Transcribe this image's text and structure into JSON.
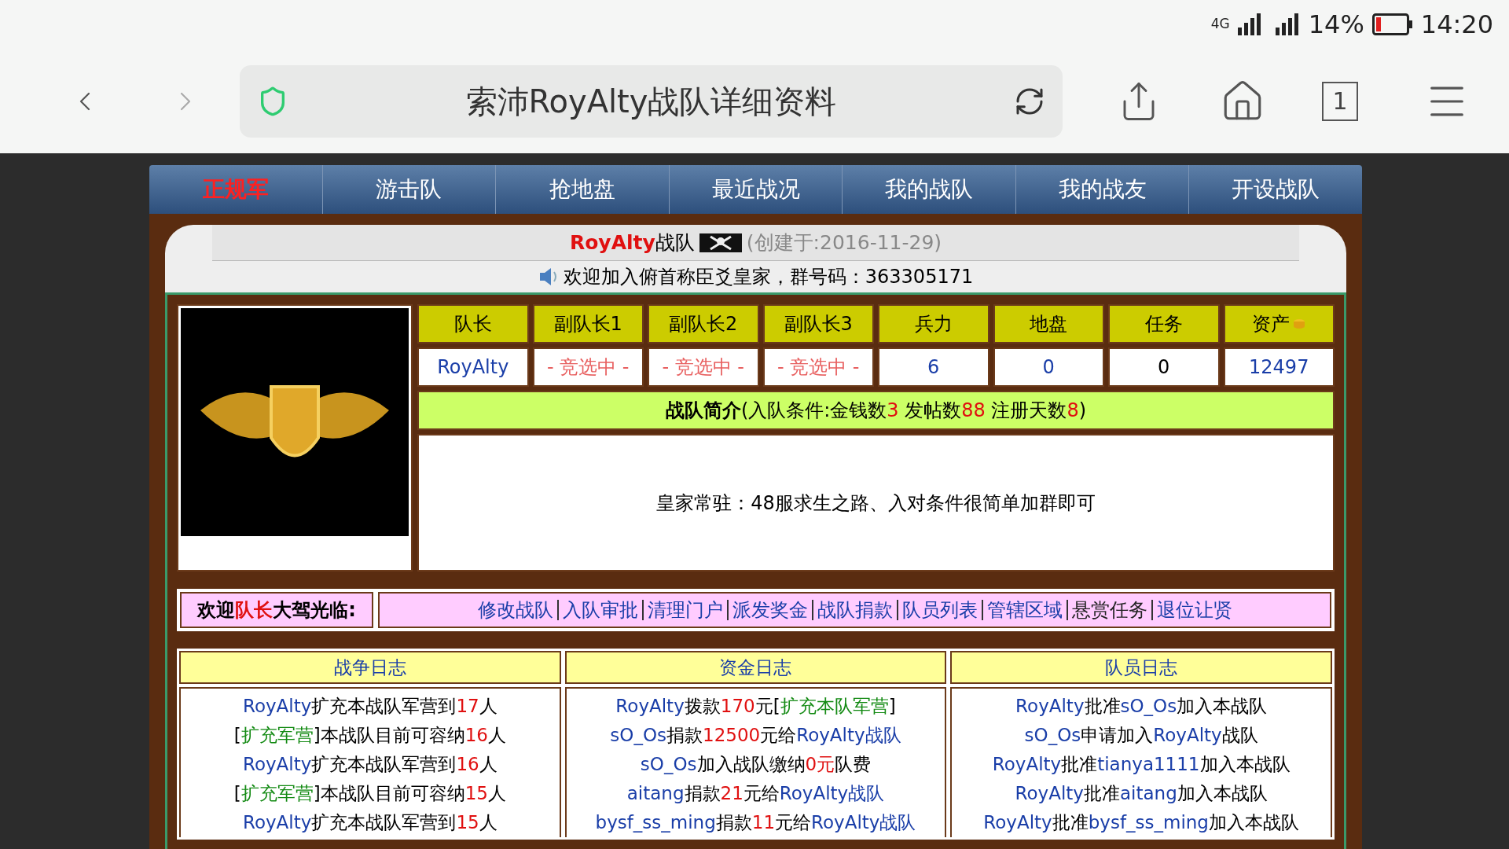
{
  "status_bar": {
    "network": "4G",
    "battery": "14%",
    "time": "14:20"
  },
  "browser": {
    "page_title": "索沛RoyAlty战队详细资料",
    "tab_count": "1"
  },
  "nav_tabs": [
    {
      "label": "正规军",
      "selected": true
    },
    {
      "label": "游击队",
      "selected": false
    },
    {
      "label": "抢地盘",
      "selected": false
    },
    {
      "label": "最近战况",
      "selected": false
    },
    {
      "label": "我的战队",
      "selected": false
    },
    {
      "label": "我的战友",
      "selected": false
    },
    {
      "label": "开设战队",
      "selected": false
    }
  ],
  "team_header": {
    "title": [
      {
        "kind": "brand",
        "text": "RoyAlty"
      },
      {
        "kind": "text",
        "text": "战队"
      }
    ],
    "created": "(创建于:2016-11-29)",
    "notice": "欢迎加入俯首称臣爻皇家，群号码：363305171"
  },
  "stats": [
    {
      "label": "队长",
      "value": "RoyAlty",
      "kind": "name"
    },
    {
      "label": "副队长1",
      "value": "- 竞选中 -",
      "kind": "pending"
    },
    {
      "label": "副队长2",
      "value": "- 竞选中 -",
      "kind": "pending"
    },
    {
      "label": "副队长3",
      "value": "- 竞选中 -",
      "kind": "pending"
    },
    {
      "label": "兵力",
      "value": "6",
      "kind": "name"
    },
    {
      "label": "地盘",
      "value": "0",
      "kind": "name"
    },
    {
      "label": "任务",
      "value": "0",
      "kind": "text"
    },
    {
      "label": "资产",
      "value": "12497",
      "kind": "name",
      "coin": true
    }
  ],
  "intro": {
    "heading": [
      {
        "kind": "bold",
        "text": "战队简介"
      },
      {
        "kind": "text",
        "text": "(入队条件:金钱数"
      },
      {
        "kind": "number",
        "text": "3"
      },
      {
        "kind": "text",
        "text": " 发帖数"
      },
      {
        "kind": "number",
        "text": "88"
      },
      {
        "kind": "text",
        "text": " 注册天数"
      },
      {
        "kind": "number",
        "text": "8"
      },
      {
        "kind": "text",
        "text": ")"
      }
    ],
    "description": "皇家常驻：48服求生之路、入对条件很简单加群即可"
  },
  "welcome": [
    {
      "kind": "text",
      "text": "欢迎"
    },
    {
      "kind": "role",
      "text": "队长"
    },
    {
      "kind": "text",
      "text": "大驾光临:"
    }
  ],
  "actions": [
    {
      "label": "修改战队",
      "kind": "link"
    },
    {
      "label": "入队审批",
      "kind": "link"
    },
    {
      "label": "清理门户",
      "kind": "link"
    },
    {
      "label": "派发奖金",
      "kind": "link"
    },
    {
      "label": "战队捐款",
      "kind": "link"
    },
    {
      "label": "队员列表",
      "kind": "link"
    },
    {
      "label": "管辖区域",
      "kind": "link"
    },
    {
      "label": "悬赏任务",
      "kind": "plain"
    },
    {
      "label": "退位让贤",
      "kind": "link"
    }
  ],
  "logs": [
    {
      "title": "战争日志",
      "entries": [
        [
          {
            "kind": "name",
            "text": "RoyAlty"
          },
          {
            "kind": "text",
            "text": "扩充本战队军营到"
          },
          {
            "kind": "number",
            "text": "17"
          },
          {
            "kind": "text",
            "text": "人"
          }
        ],
        [
          {
            "kind": "text",
            "text": "["
          },
          {
            "kind": "tag",
            "text": "扩充军营"
          },
          {
            "kind": "text",
            "text": "]本战队目前可容纳"
          },
          {
            "kind": "number",
            "text": "16"
          },
          {
            "kind": "text",
            "text": "人"
          }
        ],
        [
          {
            "kind": "name",
            "text": "RoyAlty"
          },
          {
            "kind": "text",
            "text": "扩充本战队军营到"
          },
          {
            "kind": "number",
            "text": "16"
          },
          {
            "kind": "text",
            "text": "人"
          }
        ],
        [
          {
            "kind": "text",
            "text": "["
          },
          {
            "kind": "tag",
            "text": "扩充军营"
          },
          {
            "kind": "text",
            "text": "]本战队目前可容纳"
          },
          {
            "kind": "number",
            "text": "15"
          },
          {
            "kind": "text",
            "text": "人"
          }
        ],
        [
          {
            "kind": "name",
            "text": "RoyAlty"
          },
          {
            "kind": "text",
            "text": "扩充本战队军营到"
          },
          {
            "kind": "number",
            "text": "15"
          },
          {
            "kind": "text",
            "text": "人"
          }
        ]
      ]
    },
    {
      "title": "资金日志",
      "entries": [
        [
          {
            "kind": "name",
            "text": "RoyAlty"
          },
          {
            "kind": "text",
            "text": "拨款"
          },
          {
            "kind": "number",
            "text": "170"
          },
          {
            "kind": "text",
            "text": "元["
          },
          {
            "kind": "tag",
            "text": "扩充本队军营"
          },
          {
            "kind": "text",
            "text": "]"
          }
        ],
        [
          {
            "kind": "name",
            "text": "sO_Os"
          },
          {
            "kind": "text",
            "text": "捐款"
          },
          {
            "kind": "number",
            "text": "12500"
          },
          {
            "kind": "text",
            "text": "元给"
          },
          {
            "kind": "name",
            "text": "RoyAlty战队"
          }
        ],
        [
          {
            "kind": "name",
            "text": "sO_Os"
          },
          {
            "kind": "text",
            "text": "加入战队缴纳"
          },
          {
            "kind": "number",
            "text": "0元"
          },
          {
            "kind": "text",
            "text": "队费"
          }
        ],
        [
          {
            "kind": "name",
            "text": "aitang"
          },
          {
            "kind": "text",
            "text": "捐款"
          },
          {
            "kind": "number",
            "text": "21"
          },
          {
            "kind": "text",
            "text": "元给"
          },
          {
            "kind": "name",
            "text": "RoyAlty战队"
          }
        ],
        [
          {
            "kind": "name",
            "text": "bysf_ss_ming"
          },
          {
            "kind": "text",
            "text": "捐款"
          },
          {
            "kind": "number",
            "text": "11"
          },
          {
            "kind": "text",
            "text": "元给"
          },
          {
            "kind": "name",
            "text": "RoyAlty战队"
          }
        ]
      ]
    },
    {
      "title": "队员日志",
      "entries": [
        [
          {
            "kind": "name",
            "text": "RoyAlty"
          },
          {
            "kind": "text",
            "text": "批准"
          },
          {
            "kind": "name",
            "text": "sO_Os"
          },
          {
            "kind": "text",
            "text": "加入本战队"
          }
        ],
        [
          {
            "kind": "name",
            "text": "sO_Os"
          },
          {
            "kind": "text",
            "text": "申请加入"
          },
          {
            "kind": "name",
            "text": "RoyAlty"
          },
          {
            "kind": "text",
            "text": "战队"
          }
        ],
        [
          {
            "kind": "name",
            "text": "RoyAlty"
          },
          {
            "kind": "text",
            "text": "批准"
          },
          {
            "kind": "name",
            "text": "tianya1111"
          },
          {
            "kind": "text",
            "text": "加入本战队"
          }
        ],
        [
          {
            "kind": "name",
            "text": "RoyAlty"
          },
          {
            "kind": "text",
            "text": "批准"
          },
          {
            "kind": "name",
            "text": "aitang"
          },
          {
            "kind": "text",
            "text": "加入本战队"
          }
        ],
        [
          {
            "kind": "name",
            "text": "RoyAlty"
          },
          {
            "kind": "text",
            "text": "批准"
          },
          {
            "kind": "name",
            "text": "bysf_ss_ming"
          },
          {
            "kind": "text",
            "text": "加入本战队"
          }
        ]
      ]
    }
  ]
}
